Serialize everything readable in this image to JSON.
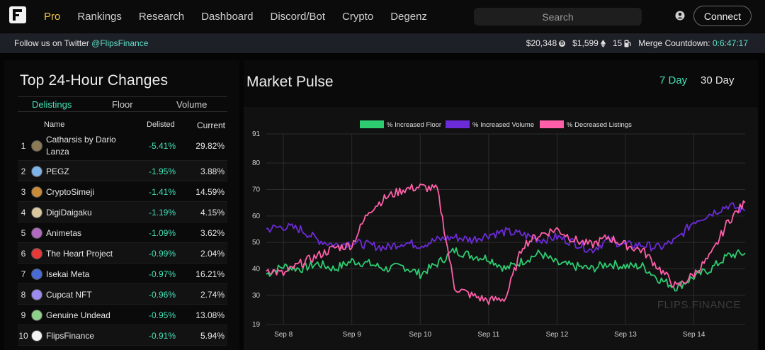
{
  "nav": {
    "logo_icon": "flips-logo-icon",
    "items": [
      "Pro",
      "Rankings",
      "Research",
      "Dashboard",
      "Discord/Bot",
      "Crypto",
      "Degenz"
    ],
    "active_index": 0,
    "search_placeholder": "Search",
    "user_icon": "user-icon",
    "connect_label": "Connect"
  },
  "subbar": {
    "follow_prefix": "Follow us on Twitter ",
    "follow_handle": "@FlipsFinance",
    "btc_price": "$20,348",
    "eth_price": "$1,599",
    "gas": "15",
    "merge_label": "Merge Countdown:",
    "merge_value": "0:6:47:17"
  },
  "left": {
    "title": "Top 24-Hour Changes",
    "tabs": [
      "Delistings",
      "Floor",
      "Volume"
    ],
    "active_tab": 0,
    "columns": {
      "name": "Name",
      "delisted": "Delisted",
      "current": "Current"
    },
    "rows": [
      {
        "rank": "1",
        "name": "Catharsis by Dario Lanza",
        "delisted": "-5.41%",
        "current": "29.82%",
        "avatar_color": "#8a7a55"
      },
      {
        "rank": "2",
        "name": "PEGZ",
        "delisted": "-1.95%",
        "current": "3.88%",
        "avatar_color": "#7fb2e6"
      },
      {
        "rank": "3",
        "name": "CryptoSimeji",
        "delisted": "-1.41%",
        "current": "14.59%",
        "avatar_color": "#c98a3a"
      },
      {
        "rank": "4",
        "name": "DigiDaigaku",
        "delisted": "-1.19%",
        "current": "4.15%",
        "avatar_color": "#d9c7a0"
      },
      {
        "rank": "5",
        "name": "Animetas",
        "delisted": "-1.09%",
        "current": "3.62%",
        "avatar_color": "#b06abf"
      },
      {
        "rank": "6",
        "name": "The Heart Project",
        "delisted": "-0.99%",
        "current": "2.04%",
        "avatar_color": "#e63939"
      },
      {
        "rank": "7",
        "name": "Isekai Meta",
        "delisted": "-0.97%",
        "current": "16.21%",
        "avatar_color": "#4a6bd6"
      },
      {
        "rank": "8",
        "name": "Cupcat NFT",
        "delisted": "-0.96%",
        "current": "2.74%",
        "avatar_color": "#9c8cf0"
      },
      {
        "rank": "9",
        "name": "Genuine Undead",
        "delisted": "-0.95%",
        "current": "13.08%",
        "avatar_color": "#8fd18a"
      },
      {
        "rank": "10",
        "name": "FlipsFinance",
        "delisted": "-0.91%",
        "current": "5.94%",
        "avatar_color": "#f2f2f2"
      }
    ]
  },
  "right": {
    "title": "Market Pulse",
    "toggles": [
      "7 Day",
      "30 Day"
    ],
    "active_toggle": 0,
    "watermark": "FLIPS.FINANCE"
  },
  "colors": {
    "accent_green": "#43e2b7",
    "active_nav": "#f4c542",
    "floor": "#2ecc71",
    "volume": "#6c2bd9",
    "listings": "#ff5fa8"
  },
  "chart_data": {
    "type": "line",
    "title": "",
    "xlabel": "",
    "ylabel": "",
    "ylim": [
      19,
      91
    ],
    "yticks": [
      19,
      30,
      40,
      50,
      60,
      70,
      80,
      91
    ],
    "x_ticks": [
      "Sep 8",
      "Sep 9",
      "Sep 10",
      "Sep 11",
      "Sep 12",
      "Sep 13",
      "Sep 14"
    ],
    "legend_position": "top-center",
    "grid": true,
    "x": [
      "Sep 7 18:00",
      "Sep 8 00:00",
      "Sep 8 06:00",
      "Sep 8 12:00",
      "Sep 8 18:00",
      "Sep 9 00:00",
      "Sep 9 06:00",
      "Sep 9 12:00",
      "Sep 9 18:00",
      "Sep 10 00:00",
      "Sep 10 06:00",
      "Sep 10 12:00",
      "Sep 10 18:00",
      "Sep 11 00:00",
      "Sep 11 06:00",
      "Sep 11 12:00",
      "Sep 11 18:00",
      "Sep 12 00:00",
      "Sep 12 06:00",
      "Sep 12 12:00",
      "Sep 12 18:00",
      "Sep 13 00:00",
      "Sep 13 06:00",
      "Sep 13 12:00",
      "Sep 13 18:00",
      "Sep 14 00:00",
      "Sep 14 06:00",
      "Sep 14 12:00",
      "Sep 14 18:00"
    ],
    "series": [
      {
        "name": "% Increased Floor",
        "color": "#2ecc71",
        "values": [
          38,
          41,
          40,
          42,
          40,
          43,
          42,
          40,
          41,
          38,
          42,
          47,
          45,
          44,
          40,
          43,
          46,
          42,
          41,
          40,
          42,
          41,
          41,
          36,
          33,
          37,
          40,
          45,
          46,
          44
        ]
      },
      {
        "name": "% Increased Volume",
        "color": "#6c2bd9",
        "values": [
          55,
          56,
          55,
          51,
          49,
          50,
          49,
          48,
          50,
          49,
          51,
          52,
          51,
          53,
          54,
          53,
          51,
          52,
          50,
          47,
          51,
          49,
          49,
          48,
          51,
          58,
          61,
          64,
          62,
          61
        ]
      },
      {
        "name": "% Decreased Listings",
        "color": "#ff5fa8",
        "values": [
          40,
          38,
          42,
          45,
          48,
          49,
          62,
          67,
          70,
          71,
          70,
          33,
          30,
          28,
          29,
          49,
          53,
          55,
          51,
          49,
          52,
          49,
          47,
          40,
          33,
          38,
          45,
          58,
          65,
          69
        ]
      }
    ]
  }
}
